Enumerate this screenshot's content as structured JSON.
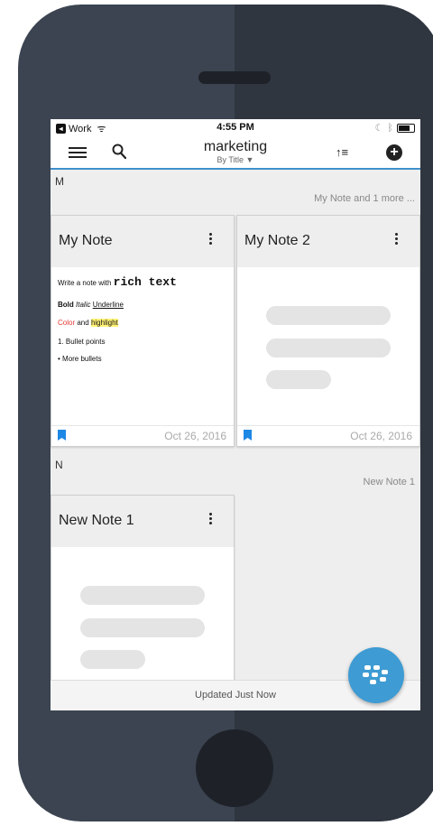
{
  "status": {
    "carrier": "Work",
    "time": "4:55 PM"
  },
  "appbar": {
    "title": "marketing",
    "subtitle": "By Title ▼",
    "sort_glyph": "↑≡",
    "add_glyph": "+"
  },
  "sections": [
    {
      "letter": "M",
      "count_text": "My Note and 1 more ...",
      "cards": [
        {
          "title": "My Note",
          "date": "Oct 26, 2016",
          "rich": {
            "line1_prefix": "Write a note with ",
            "line1_mono": "rich text",
            "bold": "Bold",
            "italic": "Italic",
            "underline": "Underline",
            "color_word": "Color",
            "and_word": "and",
            "highlight": "highlight",
            "bullet1": "1.  Bullet points",
            "bullet2": "•  More bullets"
          }
        },
        {
          "title": "My Note 2",
          "date": "Oct 26, 2016"
        }
      ]
    },
    {
      "letter": "N",
      "count_text": "New Note 1",
      "cards": [
        {
          "title": "New Note 1"
        }
      ]
    }
  ],
  "footer": {
    "text": "Updated Just Now"
  },
  "colors": {
    "accent": "#3f8fcc",
    "bookmark": "#1e88e5",
    "fab": "#3e9bd3",
    "highlight": "#fff176",
    "red_text": "#e53935"
  },
  "icons": [
    "menu-icon",
    "search-icon",
    "sort-icon",
    "add-icon",
    "bookmark-icon",
    "more-vert-icon",
    "blackberry-icon",
    "wifi-icon",
    "battery-icon",
    "bluetooth-icon"
  ]
}
